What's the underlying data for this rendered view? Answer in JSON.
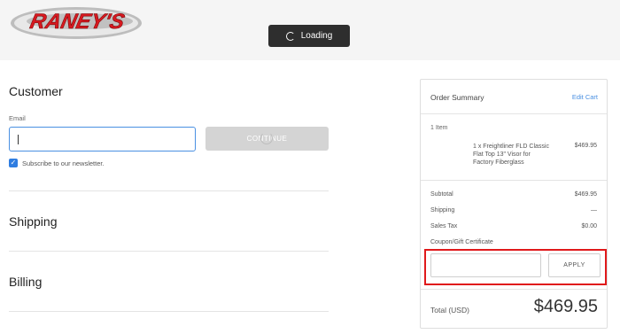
{
  "header": {
    "logo_text": "RANEY'S",
    "loading_label": "Loading"
  },
  "customer": {
    "title": "Customer",
    "email_label": "Email",
    "email_value": "",
    "continue_label": "CONTINUE",
    "newsletter_label": "Subscribe to our newsletter.",
    "newsletter_checked": true
  },
  "shipping": {
    "title": "Shipping"
  },
  "billing": {
    "title": "Billing"
  },
  "order_summary": {
    "title": "Order Summary",
    "edit_label": "Edit Cart",
    "items_count": "1 Item",
    "item": {
      "line1": "1 x Freightliner FLD Classic",
      "line2": "Flat Top 13\" Visor for",
      "line3": "Factory Fiberglass",
      "price": "$469.95"
    },
    "subtotal_label": "Subtotal",
    "subtotal_value": "$469.95",
    "shipping_label": "Shipping",
    "shipping_value": "—",
    "tax_label": "Sales Tax",
    "tax_value": "$0.00",
    "coupon_label": "Coupon/Gift Certificate",
    "coupon_value": "",
    "apply_label": "APPLY",
    "total_label": "Total (USD)",
    "total_value": "$469.95"
  },
  "colors": {
    "accent": "#4a90e2",
    "highlight": "#e0191b",
    "logo_red": "#d71920",
    "header_bg": "#f5f5f5"
  }
}
